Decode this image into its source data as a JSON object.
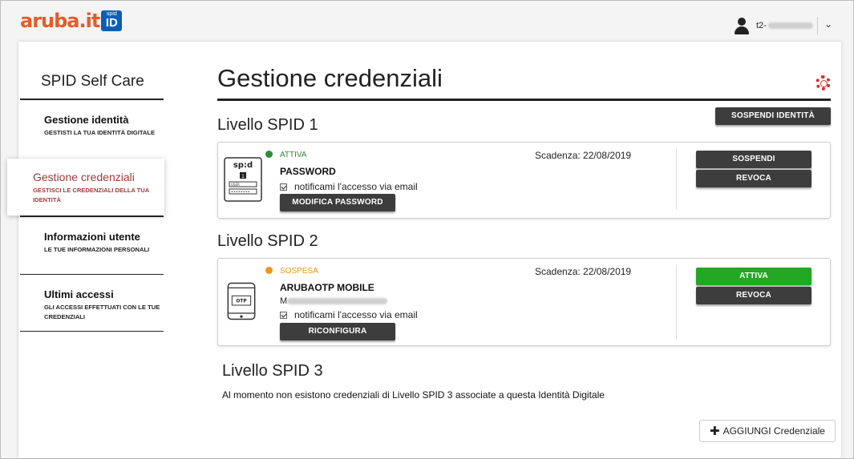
{
  "header": {
    "logo_text": "aruba.it",
    "logo_badge_small": "spid",
    "logo_badge_big": "ID",
    "user_name": "t2-"
  },
  "sidebar": {
    "title": "SPID Self Care",
    "items": [
      {
        "label": "Gestione identità",
        "sub": "Gestisti la tua identità digitale"
      },
      {
        "label": "Gestione credenziali",
        "sub": "Gestisci le credenziali della tua identità"
      },
      {
        "label": "Informazioni utente",
        "sub": "Le tue informazioni personali"
      },
      {
        "label": "Ultimi accessi",
        "sub": "Gli accessi effettuati con le tue credenziali"
      }
    ],
    "active_index": 1
  },
  "main": {
    "title": "Gestione credenziali",
    "suspend_identity_label": "SOSPENDI IDENTITÀ",
    "level1": {
      "heading": "Livello SPID 1",
      "status": "ATTIVA",
      "status_color": "#2e8b3a",
      "name": "PASSWORD",
      "expiry": "Scadenza: 22/08/2019",
      "notify_label": "notificami l'accesso via email",
      "notify_checked": true,
      "modify_label": "MODIFICA PASSWORD",
      "suspend_label": "SOSPENDI",
      "revoke_label": "REVOCA",
      "icon": "spid-login-card-icon",
      "icon_text": "sp:d"
    },
    "level2": {
      "heading": "Livello SPID 2",
      "status": "SOSPESA",
      "status_color": "#e8961e",
      "name": "ARUBAOTP MOBILE",
      "user_prefix": "M",
      "expiry": "Scadenza: 22/08/2019",
      "notify_label": "notificami l'accesso via email",
      "notify_checked": true,
      "reconfigure_label": "RICONFIGURA",
      "activate_label": "ATTIVA",
      "revoke_label": "REVOCA",
      "icon": "otp-phone-icon",
      "icon_text": "OTP"
    },
    "level3": {
      "heading": "Livello SPID 3",
      "message": "Al momento non esistono credenziali di Livello SPID 3 associate a questa Identità Digitale"
    },
    "add_button_label": "AGGIUNGI Credenziale"
  },
  "colors": {
    "brand_orange": "#e85a28",
    "brand_blue": "#0a5fb4",
    "active_sidebar": "#9c3b3b",
    "button_dark": "#3d3d3d",
    "button_green": "#22a822"
  }
}
